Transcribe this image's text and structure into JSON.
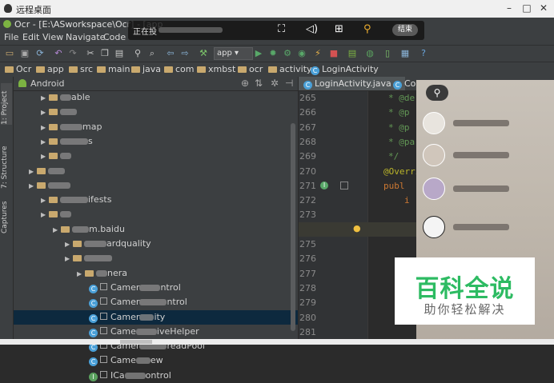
{
  "remote_desktop": {
    "title": "远程桌面",
    "status": "正在投",
    "end_label": "结束"
  },
  "ide": {
    "window_title": "Ocr - [E:\\ASworkspace\\Ocr] - [app",
    "menu": [
      "File",
      "Edit",
      "View",
      "Navigate",
      "Code"
    ],
    "run_config": "app",
    "breadcrumbs": [
      "Ocr",
      "app",
      "src",
      "main",
      "java",
      "com",
      "xmbst",
      "ocr",
      "activity",
      "LoginActivity"
    ],
    "project_view_label": "Android",
    "side_tabs": {
      "project": "1: Project",
      "structure": "7: Structure",
      "captures": "Captures"
    },
    "tree": [
      {
        "text": "able",
        "indent": 2
      },
      {
        "text": "",
        "indent": 2
      },
      {
        "text": "map",
        "indent": 2
      },
      {
        "text": "s",
        "indent": 2
      },
      {
        "text": "",
        "indent": 2
      },
      {
        "text": "",
        "indent": 1
      },
      {
        "text": "",
        "indent": 1
      },
      {
        "text": "ifests",
        "indent": 2
      },
      {
        "text": "",
        "indent": 2
      },
      {
        "text": "m.baidu",
        "indent": 3
      },
      {
        "text": "ardquality",
        "indent": 4
      },
      {
        "text": "",
        "indent": 4
      },
      {
        "text": "nera",
        "indent": 5
      },
      {
        "text": "Camer",
        "suffix": "ntrol",
        "indent": 6
      },
      {
        "text": "Camer",
        "suffix": "ntrol",
        "indent": 6
      },
      {
        "text": "Camer",
        "suffix": "ity",
        "indent": 6,
        "selected": true
      },
      {
        "text": "Came",
        "suffix": "iveHelper",
        "indent": 6
      },
      {
        "text": "Camer",
        "suffix": "readPool",
        "indent": 6
      },
      {
        "text": "Came",
        "suffix": "ew",
        "indent": 6
      },
      {
        "text": "ICa",
        "suffix": "ontrol",
        "indent": 6,
        "interface": true
      }
    ],
    "editor_tabs": [
      "LoginActivity.java",
      "Con"
    ],
    "line_numbers": [
      "265",
      "266",
      "267",
      "268",
      "269",
      "270",
      "271",
      "272",
      "273",
      "274",
      "275",
      "276",
      "277",
      "278",
      "279",
      "280",
      "281"
    ],
    "code_lines": [
      {
        "text": "* @de",
        "color": "#629755"
      },
      {
        "text": "* @p",
        "color": "#629755"
      },
      {
        "text": "* @p",
        "color": "#629755"
      },
      {
        "text": "* @pa",
        "color": "#629755"
      },
      {
        "text": "*/",
        "color": "#629755"
      },
      {
        "text": "@Overri",
        "color": "#bbb529",
        "shift": -6
      },
      {
        "text": "publ",
        "color": "#cc7832",
        "shift": -6
      },
      {
        "text": "i",
        "color": "#cc7832",
        "shift": 20
      },
      {
        "text": "",
        "color": "#a9b7c6"
      },
      {
        "text": "",
        "color": "#a9b7c6"
      },
      {
        "text": "",
        "color": "#a9b7c6"
      },
      {
        "text": "",
        "color": "#a9b7c6"
      },
      {
        "text": "",
        "color": "#a9b7c6"
      },
      {
        "text": "",
        "color": "#a9b7c6"
      },
      {
        "text": "",
        "color": "#a9b7c6"
      },
      {
        "text": "",
        "color": "#a9b7c6"
      },
      {
        "text": "",
        "color": "#a9b7c6"
      }
    ]
  },
  "watermark": {
    "big": "百科全说",
    "small": "助你轻松解决"
  },
  "colors": {
    "accent_green": "#2dbb62",
    "selection": "#0d293e"
  }
}
